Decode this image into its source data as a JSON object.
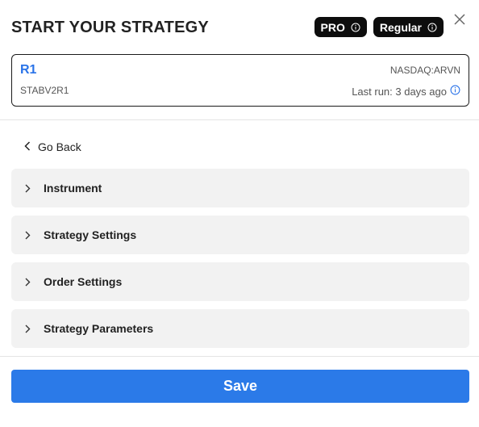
{
  "modal": {
    "title": "START YOUR STRATEGY",
    "badges": [
      {
        "label": "PRO",
        "icon": "info-icon"
      },
      {
        "label": "Regular",
        "icon": "info-icon"
      }
    ],
    "close_icon": "close-icon"
  },
  "strategy": {
    "name": "R1",
    "symbol": "NASDAQ:ARVN",
    "id": "STABV2R1",
    "last_run": "Last run: 3 days ago"
  },
  "nav": {
    "go_back_label": "Go Back"
  },
  "sections": [
    {
      "label": "Instrument"
    },
    {
      "label": "Strategy Settings"
    },
    {
      "label": "Order Settings"
    },
    {
      "label": "Strategy Parameters"
    }
  ],
  "footer": {
    "save_label": "Save"
  },
  "colors": {
    "accent": "#2b7ae8",
    "name_blue": "#2a73e8",
    "badge_bg": "#0d0d0d",
    "section_bg": "#f2f2f2"
  }
}
